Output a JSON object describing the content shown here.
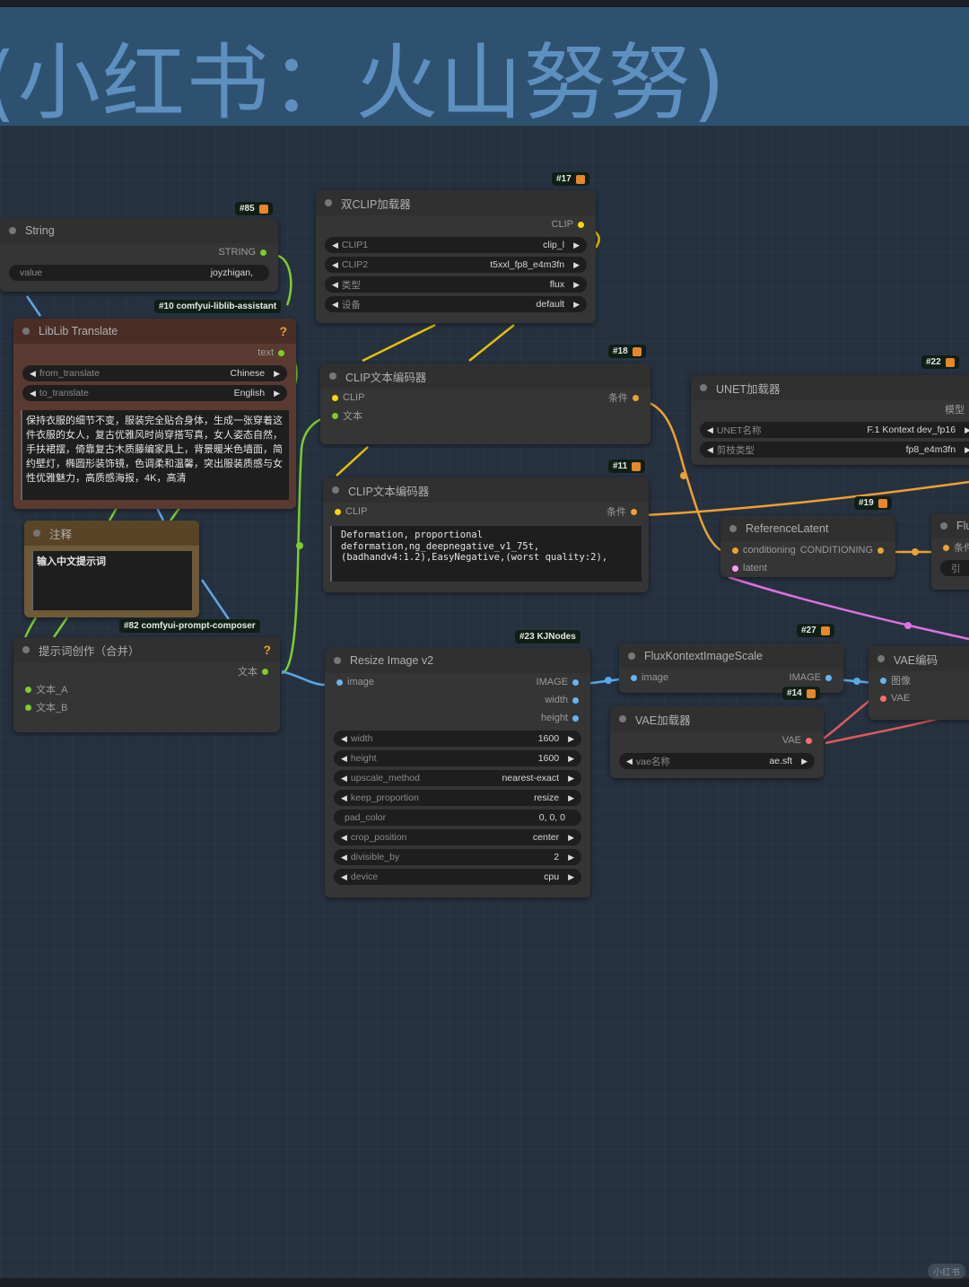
{
  "group_title": "(小红书：火山努努)",
  "watermark": "小红书",
  "colors": {
    "background": "#263140",
    "group": "#2f5170",
    "clip": "#ffd500",
    "string": "#7ccf2a",
    "conditioning": "#f0a030",
    "image": "#64b5f6",
    "latent": "#ff9cf9",
    "vae": "#ff6e6e",
    "model": "#b39ddb"
  },
  "nodes": [
    {
      "key": "string",
      "title": "String",
      "badge": "#85",
      "fox": true,
      "outputs": [
        {
          "label": "STRING",
          "type": "string"
        }
      ],
      "widgets": [
        {
          "label": "value",
          "value": "joyzhigan,",
          "arrows": false
        }
      ]
    },
    {
      "key": "liblib",
      "title": "LibLib Translate",
      "badge": "#10 comfyui-liblib-assistant",
      "help": "?",
      "outputs": [
        {
          "label": "text",
          "type": "string"
        }
      ],
      "widgets": [
        {
          "label": "from_translate",
          "value": "Chinese",
          "arrows": true
        },
        {
          "label": "to_translate",
          "value": "English",
          "arrows": true
        }
      ],
      "text": "保持衣服的细节不变，服装完全贴合身体，生成一张穿着这件衣服的女人，复古优雅风时尚穿搭写真，女人姿态自然，手扶裙摆，倚靠复古木质藤编家具上，背景暖米色墙面，简约壁灯，椭圆形装饰镜，色调柔和温馨，突出服装质感与女性优雅魅力，高质感海报，4K，高清"
    },
    {
      "key": "note",
      "title": "注释",
      "text": "输入中文提示词"
    },
    {
      "key": "composer",
      "title": "提示词创作（合并）",
      "badge": "#82 comfyui-prompt-composer",
      "help": "?",
      "outputs": [
        {
          "label": "文本",
          "type": "string"
        }
      ],
      "inputs": [
        {
          "label": "文本_A",
          "type": "string"
        },
        {
          "label": "文本_B",
          "type": "string"
        }
      ]
    },
    {
      "key": "dualclip",
      "title": "双CLIP加载器",
      "badge": "#17",
      "fox": true,
      "outputs": [
        {
          "label": "CLIP",
          "type": "clip"
        }
      ],
      "widgets": [
        {
          "label": "CLIP1",
          "value": "clip_l",
          "arrows": true
        },
        {
          "label": "CLIP2",
          "value": "t5xxl_fp8_e4m3fn",
          "arrows": true
        },
        {
          "label": "类型",
          "value": "flux",
          "arrows": true
        },
        {
          "label": "设备",
          "value": "default",
          "arrows": true
        }
      ]
    },
    {
      "key": "clip18",
      "title": "CLIP文本编码器",
      "badge": "#18",
      "fox": true,
      "inputs": [
        {
          "label": "CLIP",
          "type": "clip"
        },
        {
          "label": "文本",
          "type": "string"
        }
      ],
      "outputs": [
        {
          "label": "条件",
          "type": "conditioning"
        }
      ]
    },
    {
      "key": "clip11",
      "title": "CLIP文本编码器",
      "badge": "#11",
      "fox": true,
      "inputs": [
        {
          "label": "CLIP",
          "type": "clip"
        }
      ],
      "outputs": [
        {
          "label": "条件",
          "type": "conditioning"
        }
      ],
      "text": "  Deformation, proportional deformation,ng_deepnegative_v1_75t,(badhandv4:1.2),EasyNegative,(worst quality:2),"
    },
    {
      "key": "unet",
      "title": "UNET加载器",
      "badge": "#22",
      "fox": true,
      "outputs": [
        {
          "label": "模型",
          "type": "model"
        }
      ],
      "widgets": [
        {
          "label": "UNET名称",
          "value": "F.1 Kontext dev_fp16",
          "arrows": true
        },
        {
          "label": "剪枝类型",
          "value": "fp8_e4m3fn",
          "arrows": true
        }
      ]
    },
    {
      "key": "reflatent",
      "title": "ReferenceLatent",
      "badge": "#19",
      "fox": true,
      "inputs": [
        {
          "label": "conditioning",
          "type": "conditioning",
          "out": "CONDITIONING"
        },
        {
          "label": "latent",
          "type": "latent"
        }
      ]
    },
    {
      "key": "flu",
      "title": "Flu",
      "inputs": [
        {
          "label": "条件",
          "type": "conditioning"
        }
      ],
      "widgets": [
        {
          "label": "引",
          "value": "",
          "arrows": false
        }
      ]
    },
    {
      "key": "resize",
      "title": "Resize Image v2",
      "badge": "#23 KJNodes",
      "inputs": [
        {
          "label": "image",
          "type": "image",
          "out": "IMAGE"
        }
      ],
      "outputs": [
        {
          "label": "width",
          "type": "image"
        },
        {
          "label": "height",
          "type": "image"
        }
      ],
      "widgets": [
        {
          "label": "width",
          "value": "1600",
          "arrows": true
        },
        {
          "label": "height",
          "value": "1600",
          "arrows": true
        },
        {
          "label": "upscale_method",
          "value": "nearest-exact",
          "arrows": true
        },
        {
          "label": "keep_proportion",
          "value": "resize",
          "arrows": true
        },
        {
          "label": "pad_color",
          "value": "0, 0, 0",
          "arrows": false
        },
        {
          "label": "crop_position",
          "value": "center",
          "arrows": true
        },
        {
          "label": "divisible_by",
          "value": "2",
          "arrows": true
        },
        {
          "label": "device",
          "value": "cpu",
          "arrows": true
        }
      ]
    },
    {
      "key": "fluxscale",
      "title": "FluxKontextImageScale",
      "badge": "#27",
      "fox": true,
      "inputs": [
        {
          "label": "image",
          "type": "image",
          "out": "IMAGE"
        }
      ]
    },
    {
      "key": "vaeload",
      "title": "VAE加载器",
      "badge": "#14",
      "fox": true,
      "outputs": [
        {
          "label": "VAE",
          "type": "vae"
        }
      ],
      "widgets": [
        {
          "label": "vae名称",
          "value": "ae.sft",
          "arrows": true
        }
      ]
    },
    {
      "key": "vaeenc",
      "title": "VAE编码",
      "inputs": [
        {
          "label": "图像",
          "type": "image"
        },
        {
          "label": "VAE",
          "type": "vae"
        }
      ]
    }
  ]
}
